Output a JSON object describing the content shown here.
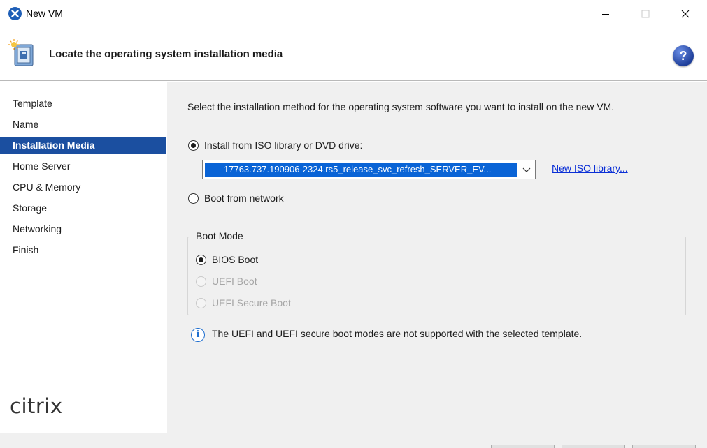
{
  "window": {
    "title": "New VM",
    "icon": "xenserver-app-icon",
    "controls": [
      "minimize-icon",
      "maximize-icon",
      "close-icon"
    ]
  },
  "header": {
    "title": "Locate the operating system installation media",
    "help_label": "?"
  },
  "sidebar": {
    "items": [
      {
        "label": "Template",
        "active": false
      },
      {
        "label": "Name",
        "active": false
      },
      {
        "label": "Installation Media",
        "active": true
      },
      {
        "label": "Home Server",
        "active": false
      },
      {
        "label": "CPU & Memory",
        "active": false
      },
      {
        "label": "Storage",
        "active": false
      },
      {
        "label": "Networking",
        "active": false
      },
      {
        "label": "Finish",
        "active": false
      }
    ],
    "logo_text": "citrix"
  },
  "main": {
    "instruction": "Select the installation method for the operating system software you want to install on the new VM.",
    "install_from_iso": {
      "label": "Install from ISO library or DVD drive:",
      "checked": true
    },
    "iso_select": {
      "value": "17763.737.190906-2324.rs5_release_svc_refresh_SERVER_EV..."
    },
    "new_iso_link": "New ISO library...",
    "boot_from_network": {
      "label": "Boot from network",
      "checked": false
    },
    "boot_mode": {
      "title": "Boot Mode",
      "options": [
        {
          "label": "BIOS Boot",
          "checked": true,
          "enabled": true
        },
        {
          "label": "UEFI Boot",
          "checked": false,
          "enabled": false
        },
        {
          "label": "UEFI Secure Boot",
          "checked": false,
          "enabled": false
        }
      ]
    },
    "info_text": "The UEFI and UEFI secure boot modes are not supported with the selected template."
  },
  "colors": {
    "accent": "#1b4fa0",
    "selection": "#0a64d6",
    "link": "#0a2fd6",
    "panel_bg": "#f0f0f0"
  }
}
